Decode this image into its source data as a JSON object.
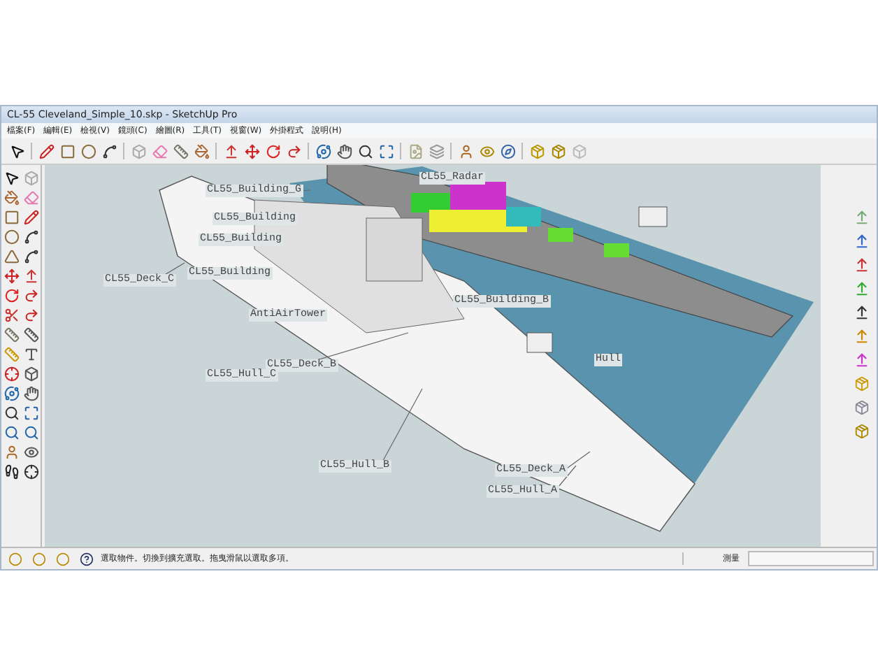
{
  "window": {
    "title": "CL-55 Cleveland_Simple_10.skp - SketchUp Pro"
  },
  "menu": [
    "檔案(F)",
    "編輯(E)",
    "檢視(V)",
    "鏡頭(C)",
    "繪圖(R)",
    "工具(T)",
    "視窗(W)",
    "外掛程式",
    "說明(H)"
  ],
  "viewport": {
    "labels": [
      {
        "text": "CL55_Building_G"
      },
      {
        "text": "CL55_Radar"
      },
      {
        "text": "CL55_Building"
      },
      {
        "text": "CL55_Building"
      },
      {
        "text": "CL55_Deck_C"
      },
      {
        "text": "CL55_Building"
      },
      {
        "text": "CL55_Building_B"
      },
      {
        "text": "AntiAirTower"
      },
      {
        "text": "CL55_Deck_B"
      },
      {
        "text": "CL55_Hull_C"
      },
      {
        "text": "CL55_Hull_B"
      },
      {
        "text": "CL55_Deck_A"
      },
      {
        "text": "CL55_Hull_A"
      },
      {
        "text": "Hull"
      }
    ]
  },
  "status_bar": {
    "message": "選取物件。切換到擴充選取。拖曳滑鼠以選取多項。",
    "measure_label": "測量"
  }
}
